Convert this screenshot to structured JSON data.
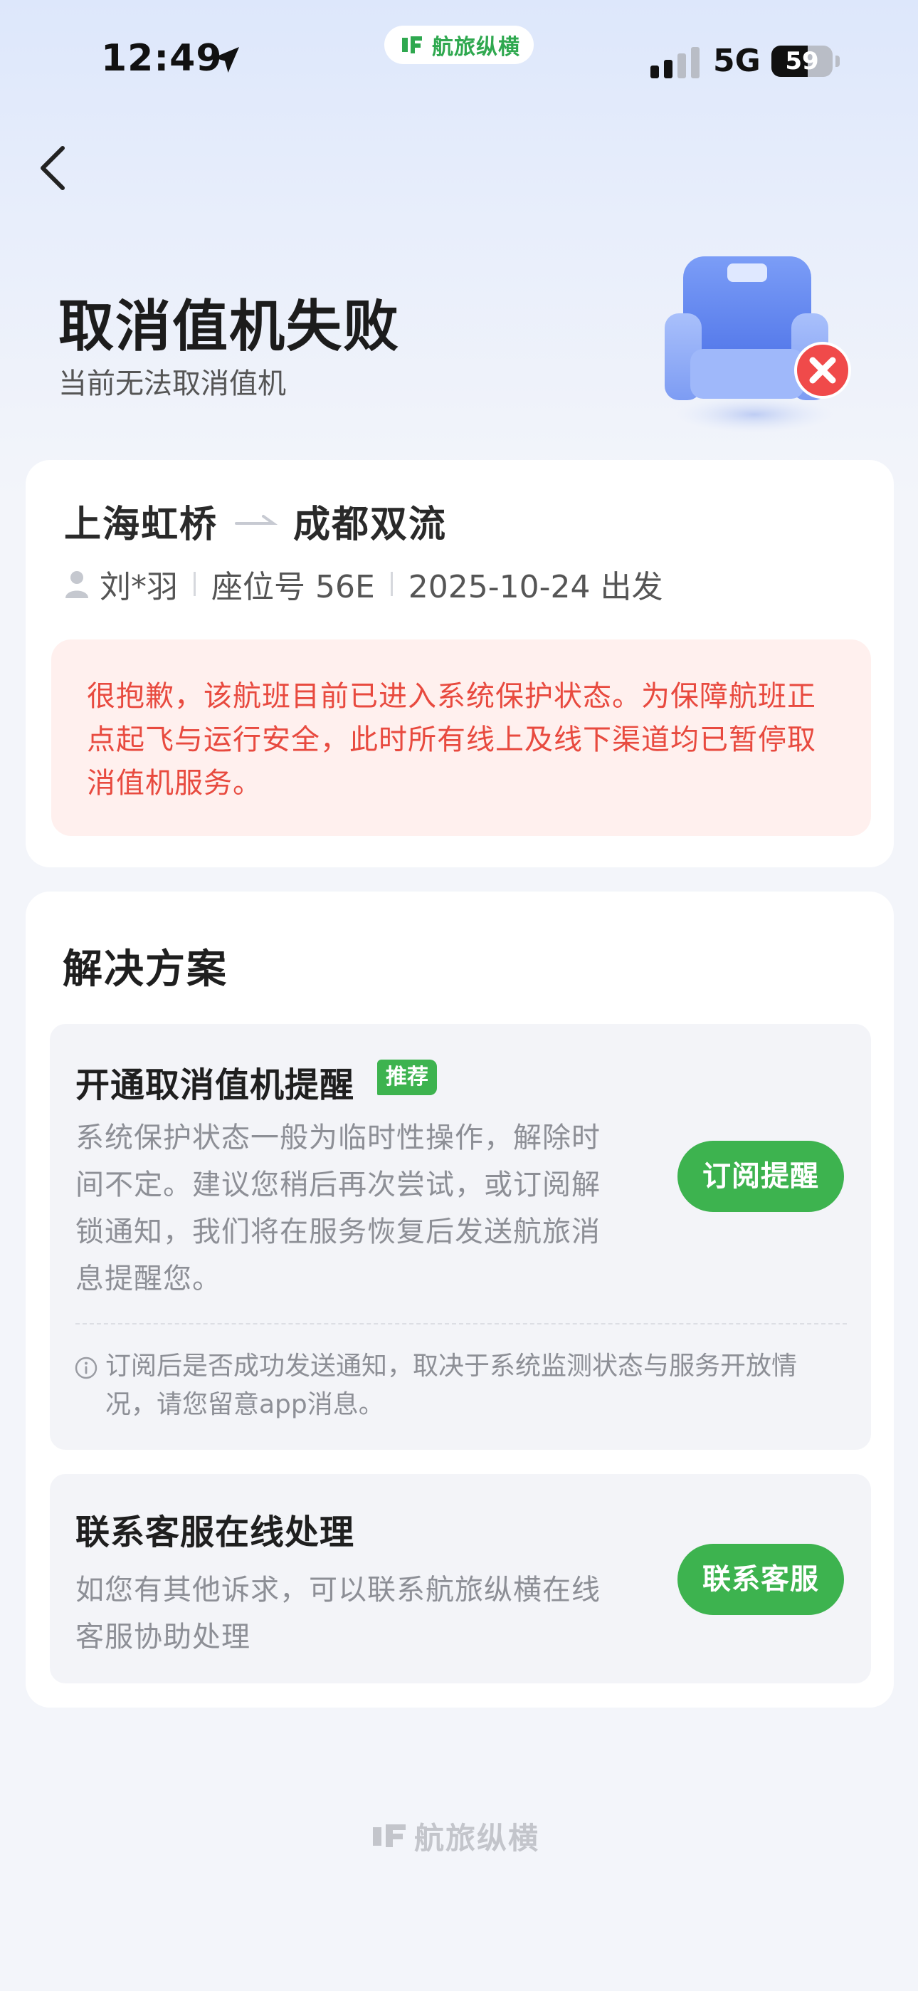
{
  "status_bar": {
    "time": "12:49",
    "network": "5G",
    "battery": "59",
    "battery_level": 0.59,
    "pill_brand": "航旅纵横"
  },
  "header": {
    "title": "取消值机失败",
    "subtitle": "当前无法取消值机"
  },
  "flight": {
    "origin": "上海虹桥",
    "destination": "成都双流",
    "passenger": "刘*羽",
    "seat": "座位号 56E",
    "departure": "2025-10-24 出发"
  },
  "alert_text": "很抱歉，该航班目前已进入系统保护状态。为保障航班正点起飞与运行安全，此时所有线上及线下渠道均已暂停取消值机服务。",
  "solutions": {
    "title": "解决方案",
    "option1": {
      "title": "开通取消值机提醒",
      "badge": "推荐",
      "desc": "系统保护状态一般为临时性操作，解除时间不定。建议您稍后再次尝试，或订阅解锁通知，我们将在服务恢复后发送航旅消息提醒您。",
      "button": "订阅提醒",
      "note": "订阅后是否成功发送通知，取决于系统监测状态与服务开放情况，请您留意app消息。"
    },
    "option2": {
      "title": "联系客服在线处理",
      "desc": "如您有其他诉求，可以联系航旅纵横在线客服协助处理",
      "button": "联系客服"
    }
  },
  "footer": {
    "brand": "航旅纵横"
  },
  "colors": {
    "accent_green": "#3db34f",
    "alert_red": "#e84a3f",
    "alert_bg": "#fff0ee",
    "page_bg": "#f3f5fa"
  },
  "icons": [
    "location-arrow-icon",
    "signal-icon",
    "battery-icon",
    "back-chevron-icon",
    "seat-cancel-illustration",
    "route-arrow-icon",
    "person-icon",
    "info-icon",
    "brand-logo-icon"
  ]
}
